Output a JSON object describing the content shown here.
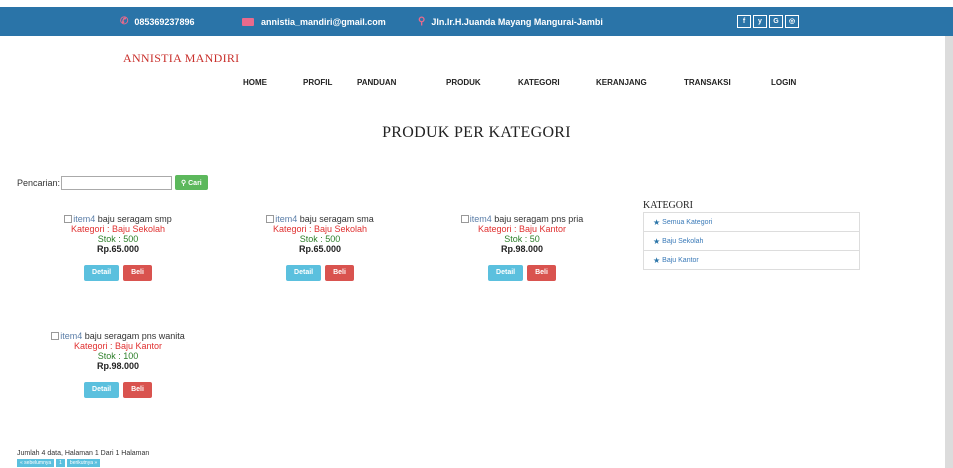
{
  "topbar": {
    "phone": "085369237896",
    "email": "annistia_mandiri@gmail.com",
    "address": "Jln.Ir.H.Juanda Mayang Mangurai-Jambi",
    "social": [
      "f",
      "y",
      "G",
      "◎"
    ]
  },
  "brand": "ANNISTIA MANDIRI",
  "nav": [
    "HOME",
    "PROFIL",
    "PANDUAN",
    "PRODUK",
    "KATEGORI",
    "KERANJANG",
    "TRANSAKSI",
    "LOGIN"
  ],
  "page_title": "PRODUK PER KATEGORI",
  "search": {
    "label": "Pencarian:",
    "value": "",
    "button": "Cari"
  },
  "products": [
    {
      "img_alt": "item4",
      "name": "baju seragam smp",
      "category": "Kategori : Baju Sekolah",
      "stock": "Stok : 500",
      "price": "Rp.65.000"
    },
    {
      "img_alt": "item4",
      "name": "baju seragam sma",
      "category": "Kategori : Baju Sekolah",
      "stock": "Stok : 500",
      "price": "Rp.65.000"
    },
    {
      "img_alt": "item4",
      "name": "baju seragam pns pria",
      "category": "Kategori : Baju Kantor",
      "stock": "Stok : 50",
      "price": "Rp.98.000"
    },
    {
      "img_alt": "item4",
      "name": "baju seragam pns wanita",
      "category": "Kategori : Baju Kantor",
      "stock": "Stok : 100",
      "price": "Rp.98.000"
    }
  ],
  "buttons": {
    "detail": "Detail",
    "beli": "Beli"
  },
  "category_panel": {
    "title": "KATEGORI",
    "items": [
      "Semua Kategori",
      "Baju Sekolah",
      "Baju Kantor"
    ]
  },
  "footer": {
    "info": "Jumlah 4 data, Halaman 1 Dari 1 Halaman",
    "prev": "« sebelumnya",
    "page": "1",
    "next": "berikutnya »"
  },
  "colors": {
    "topbar": "#2a74a8",
    "brand": "#c9302c",
    "detail": "#5bc0de",
    "beli": "#d9534f",
    "cari": "#5cb85c"
  }
}
